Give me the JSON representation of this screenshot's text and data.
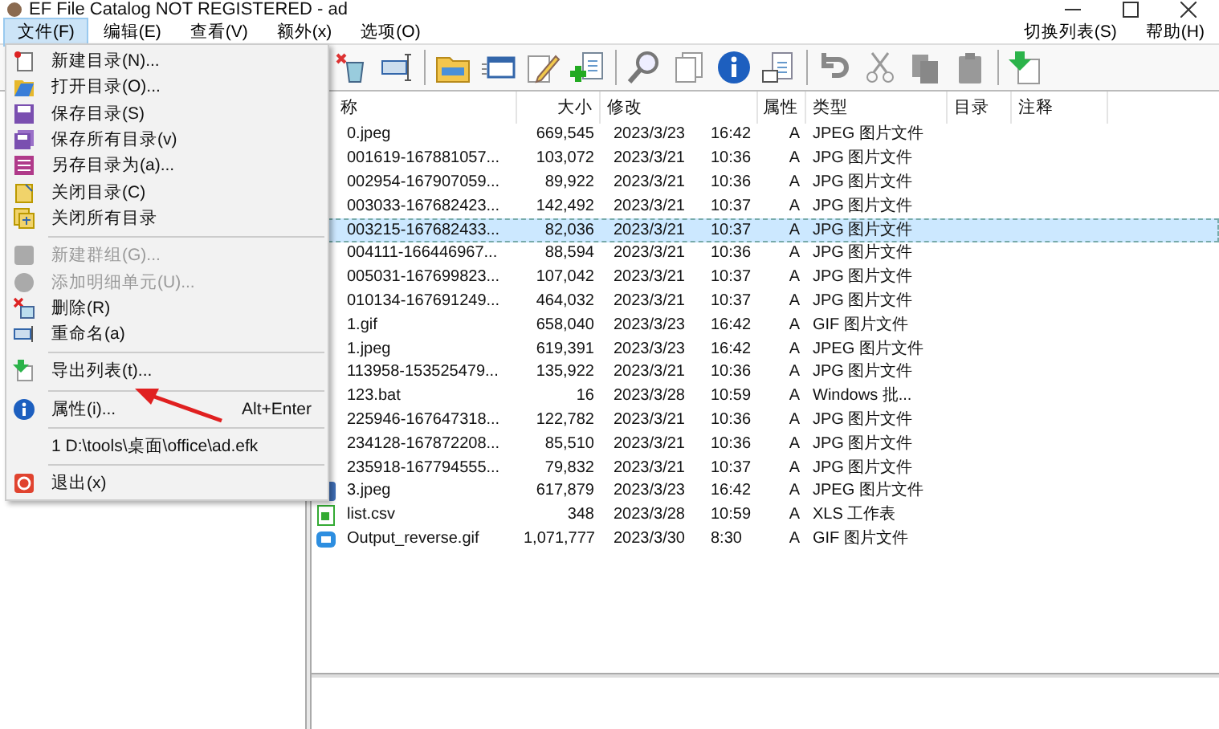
{
  "window": {
    "title": "EF File Catalog NOT REGISTERED - ad"
  },
  "menubar": {
    "left": [
      {
        "label": "文件(F)",
        "selected": true
      },
      {
        "label": "编辑(E)",
        "selected": false
      },
      {
        "label": "查看(V)",
        "selected": false
      },
      {
        "label": "额外(x)",
        "selected": false
      },
      {
        "label": "选项(O)",
        "selected": false
      }
    ],
    "right": [
      {
        "label": "切换列表(S)",
        "selected": false
      },
      {
        "label": "帮助(H)",
        "selected": false
      }
    ]
  },
  "file_menu": [
    {
      "kind": "item",
      "label": "新建目录(N)...",
      "disabled": false
    },
    {
      "kind": "item",
      "label": "打开目录(O)...",
      "disabled": false
    },
    {
      "kind": "item",
      "label": "保存目录(S)",
      "disabled": false
    },
    {
      "kind": "item",
      "label": "保存所有目录(v)",
      "disabled": false
    },
    {
      "kind": "item",
      "label": "另存目录为(a)...",
      "disabled": false
    },
    {
      "kind": "item",
      "label": "关闭目录(C)",
      "disabled": false
    },
    {
      "kind": "item",
      "label": "关闭所有目录",
      "disabled": false
    },
    {
      "kind": "separator"
    },
    {
      "kind": "item",
      "label": "新建群组(G)...",
      "disabled": true
    },
    {
      "kind": "item",
      "label": "添加明细单元(U)...",
      "disabled": true
    },
    {
      "kind": "item",
      "label": "删除(R)",
      "disabled": false
    },
    {
      "kind": "item",
      "label": "重命名(a)",
      "disabled": false
    },
    {
      "kind": "separator"
    },
    {
      "kind": "item",
      "label": "导出列表(t)...",
      "disabled": false
    },
    {
      "kind": "separator"
    },
    {
      "kind": "item",
      "label": "属性(i)...",
      "shortcut": "Alt+Enter",
      "disabled": false
    },
    {
      "kind": "separator"
    },
    {
      "kind": "item",
      "label": "1 D:\\tools\\桌面\\office\\ad.efk",
      "disabled": false
    },
    {
      "kind": "separator"
    },
    {
      "kind": "item",
      "label": "退出(x)",
      "disabled": false
    }
  ],
  "table": {
    "columns": [
      "称",
      "大小",
      "修改",
      "属性",
      "类型",
      "目录",
      "注释"
    ],
    "rows": [
      {
        "name": "0.jpeg",
        "size": "669,545",
        "date": "2023/3/23",
        "time": "16:42",
        "attr": "A",
        "type": "JPEG 图片文件",
        "selected": false
      },
      {
        "name": "001619-167881057...",
        "size": "103,072",
        "date": "2023/3/21",
        "time": "10:36",
        "attr": "A",
        "type": "JPG 图片文件",
        "selected": false
      },
      {
        "name": "002954-167907059...",
        "size": "89,922",
        "date": "2023/3/21",
        "time": "10:36",
        "attr": "A",
        "type": "JPG 图片文件",
        "selected": false
      },
      {
        "name": "003033-167682423...",
        "size": "142,492",
        "date": "2023/3/21",
        "time": "10:37",
        "attr": "A",
        "type": "JPG 图片文件",
        "selected": false
      },
      {
        "name": "003215-167682433...",
        "size": "82,036",
        "date": "2023/3/21",
        "time": "10:37",
        "attr": "A",
        "type": "JPG 图片文件",
        "selected": true
      },
      {
        "name": "004111-166446967...",
        "size": "88,594",
        "date": "2023/3/21",
        "time": "10:36",
        "attr": "A",
        "type": "JPG 图片文件",
        "selected": false
      },
      {
        "name": "005031-167699823...",
        "size": "107,042",
        "date": "2023/3/21",
        "time": "10:37",
        "attr": "A",
        "type": "JPG 图片文件",
        "selected": false
      },
      {
        "name": "010134-167691249...",
        "size": "464,032",
        "date": "2023/3/21",
        "time": "10:37",
        "attr": "A",
        "type": "JPG 图片文件",
        "selected": false
      },
      {
        "name": "1.gif",
        "size": "658,040",
        "date": "2023/3/23",
        "time": "16:42",
        "attr": "A",
        "type": "GIF 图片文件",
        "selected": false
      },
      {
        "name": "1.jpeg",
        "size": "619,391",
        "date": "2023/3/23",
        "time": "16:42",
        "attr": "A",
        "type": "JPEG 图片文件",
        "selected": false
      },
      {
        "name": "113958-153525479...",
        "size": "135,922",
        "date": "2023/3/21",
        "time": "10:36",
        "attr": "A",
        "type": "JPG 图片文件",
        "selected": false
      },
      {
        "name": "123.bat",
        "size": "16",
        "date": "2023/3/28",
        "time": "10:59",
        "attr": "A",
        "type": "Windows 批...",
        "selected": false
      },
      {
        "name": "225946-167647318...",
        "size": "122,782",
        "date": "2023/3/21",
        "time": "10:36",
        "attr": "A",
        "type": "JPG 图片文件",
        "selected": false
      },
      {
        "name": "234128-167872208...",
        "size": "85,510",
        "date": "2023/3/21",
        "time": "10:36",
        "attr": "A",
        "type": "JPG 图片文件",
        "selected": false
      },
      {
        "name": "235918-167794555...",
        "size": "79,832",
        "date": "2023/3/21",
        "time": "10:37",
        "attr": "A",
        "type": "JPG 图片文件",
        "selected": false
      },
      {
        "name": "3.jpeg",
        "size": "617,879",
        "date": "2023/3/23",
        "time": "16:42",
        "attr": "A",
        "type": "JPEG 图片文件",
        "selected": false,
        "kind": "image"
      },
      {
        "name": "list.csv",
        "size": "348",
        "date": "2023/3/28",
        "time": "10:59",
        "attr": "A",
        "type": "XLS 工作表",
        "selected": false,
        "kind": "sheet"
      },
      {
        "name": "Output_reverse.gif",
        "size": "1,071,777",
        "date": "2023/3/30",
        "time": "8:30",
        "attr": "A",
        "type": "GIF 图片文件",
        "selected": false,
        "kind": "gif"
      }
    ]
  }
}
